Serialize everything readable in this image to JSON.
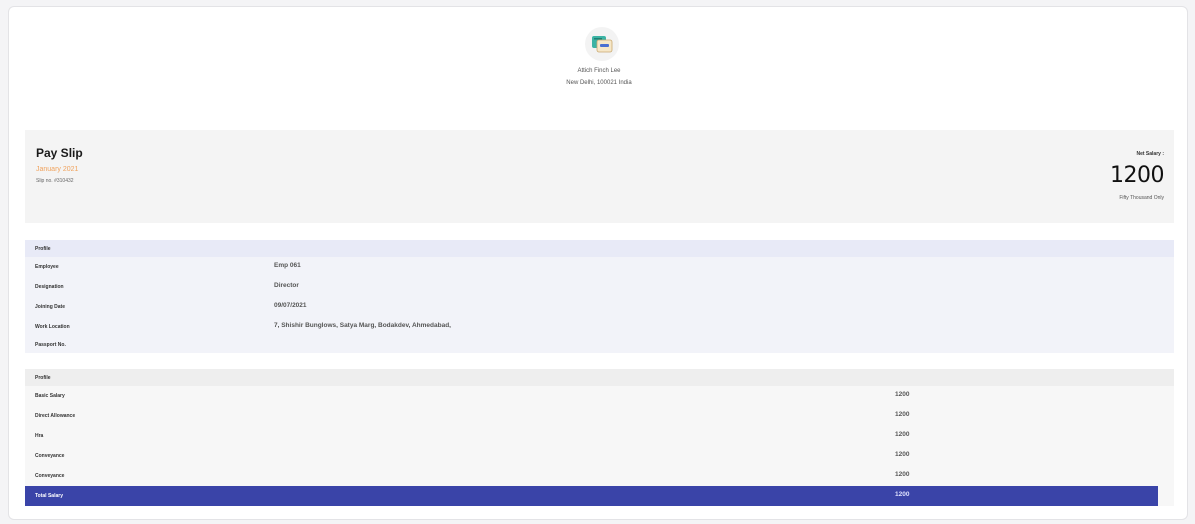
{
  "company": {
    "name": "Attich Finch Lee",
    "address": "New Delhi, 100021 India",
    "logo_icon": "wallet-icon"
  },
  "slip": {
    "title": "Pay Slip",
    "month": "January 2021",
    "slip_no": "Slip no. #310432",
    "net_label": "Net Salary :",
    "net_value": "1200",
    "net_words": "Fifty Thousand Only"
  },
  "profile": {
    "header": "Profile",
    "rows": [
      {
        "label": "Employee",
        "value": "Emp 061"
      },
      {
        "label": "Designation",
        "value": "Director"
      },
      {
        "label": "Joining Date",
        "value": "09/07/2021"
      },
      {
        "label": "Work Location",
        "value": "7, Shishir Bunglows, Satya Marg, Bodakdev, Ahmedabad,"
      },
      {
        "label": "Passport No.",
        "value": ""
      }
    ]
  },
  "earnings": {
    "header": "Profile",
    "rows": [
      {
        "label": "Basic Salary",
        "amount": "1200"
      },
      {
        "label": "Direct Allowance",
        "amount": "1200"
      },
      {
        "label": "Hra",
        "amount": "1200"
      },
      {
        "label": "Conveyance",
        "amount": "1200"
      },
      {
        "label": "Conveyance",
        "amount": "1200"
      }
    ],
    "total_label": "Total Salary",
    "total_amount": "1200"
  },
  "colors": {
    "accent": "#3a44a8",
    "month": "#f0a35e"
  }
}
